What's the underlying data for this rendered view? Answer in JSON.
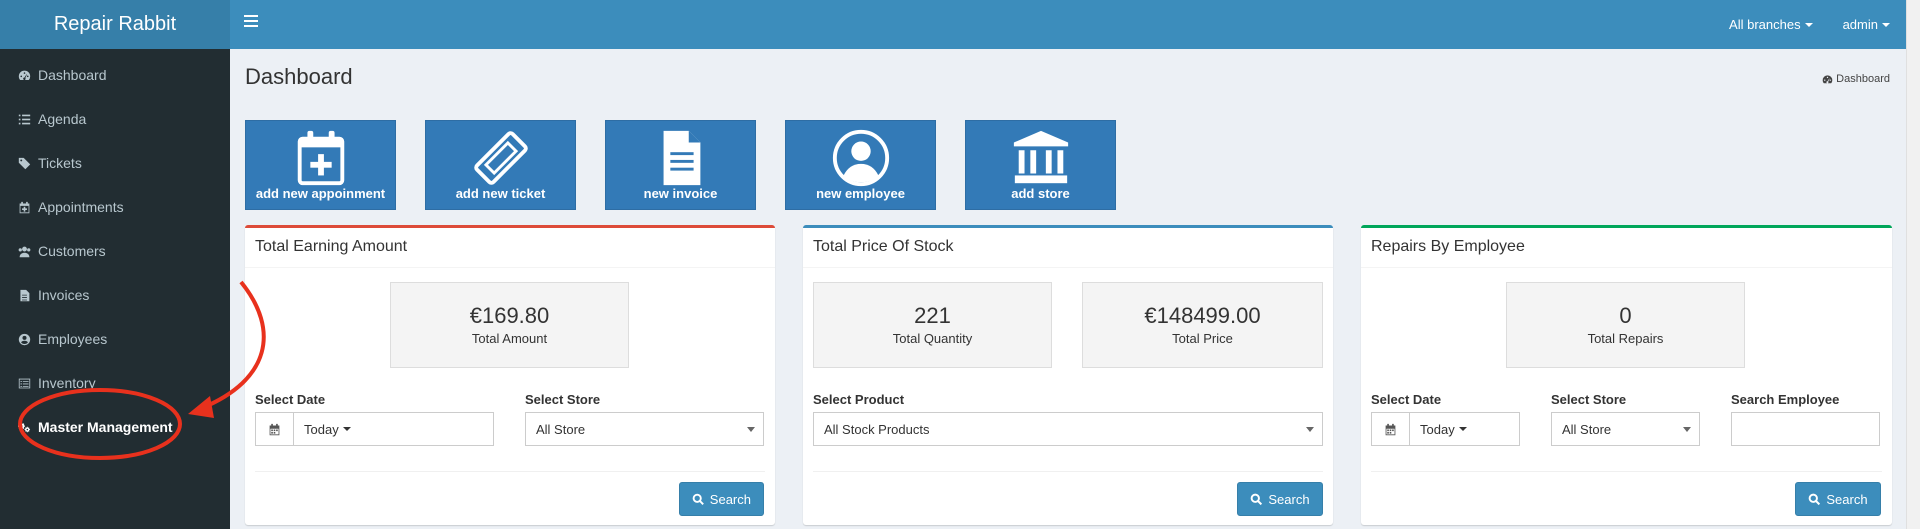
{
  "app": {
    "brand": "Repair Rabbit"
  },
  "header": {
    "branches_label": "All branches",
    "user_label": "admin"
  },
  "sidebar": {
    "items": [
      {
        "label": "Dashboard",
        "icon": "dashboard-icon"
      },
      {
        "label": "Agenda",
        "icon": "list-icon"
      },
      {
        "label": "Tickets",
        "icon": "tag-icon"
      },
      {
        "label": "Appointments",
        "icon": "calendar-plus-icon"
      },
      {
        "label": "Customers",
        "icon": "users-icon"
      },
      {
        "label": "Invoices",
        "icon": "file-text-icon"
      },
      {
        "label": "Employees",
        "icon": "user-circle-icon"
      },
      {
        "label": "Inventory",
        "icon": "list-alt-icon"
      },
      {
        "label": "Master Management",
        "icon": "cogs-icon"
      }
    ]
  },
  "page": {
    "title": "Dashboard",
    "breadcrumb": "Dashboard"
  },
  "tiles": [
    {
      "label": "add new appoinment",
      "icon": "calendar-plus-icon"
    },
    {
      "label": "add new ticket",
      "icon": "ticket-icon"
    },
    {
      "label": "new invoice",
      "icon": "file-text-icon"
    },
    {
      "label": "new employee",
      "icon": "user-circle-icon"
    },
    {
      "label": "add store",
      "icon": "bank-icon"
    }
  ],
  "panels": {
    "earning": {
      "title": "Total Earning Amount",
      "stat_value": "€169.80",
      "stat_label": "Total Amount",
      "date_label": "Select Date",
      "date_value": "Today",
      "store_label": "Select Store",
      "store_value": "All Store",
      "search_label": "Search"
    },
    "stock": {
      "title": "Total Price Of Stock",
      "qty_value": "221",
      "qty_label": "Total Quantity",
      "price_value": "€148499.00",
      "price_label": "Total Price",
      "product_label": "Select Product",
      "product_value": "All Stock Products",
      "search_label": "Search"
    },
    "repairs": {
      "title": "Repairs By Employee",
      "stat_value": "0",
      "stat_label": "Total Repairs",
      "date_label": "Select Date",
      "date_value": "Today",
      "store_label": "Select Store",
      "store_value": "All Store",
      "employee_label": "Search Employee",
      "employee_value": "",
      "search_label": "Search"
    }
  },
  "colors": {
    "sidebar": "#222d32",
    "header": "#3c8dbc",
    "brand_bar": "#367fa9",
    "tile": "#337ab7",
    "annotation": "#e8311d"
  }
}
